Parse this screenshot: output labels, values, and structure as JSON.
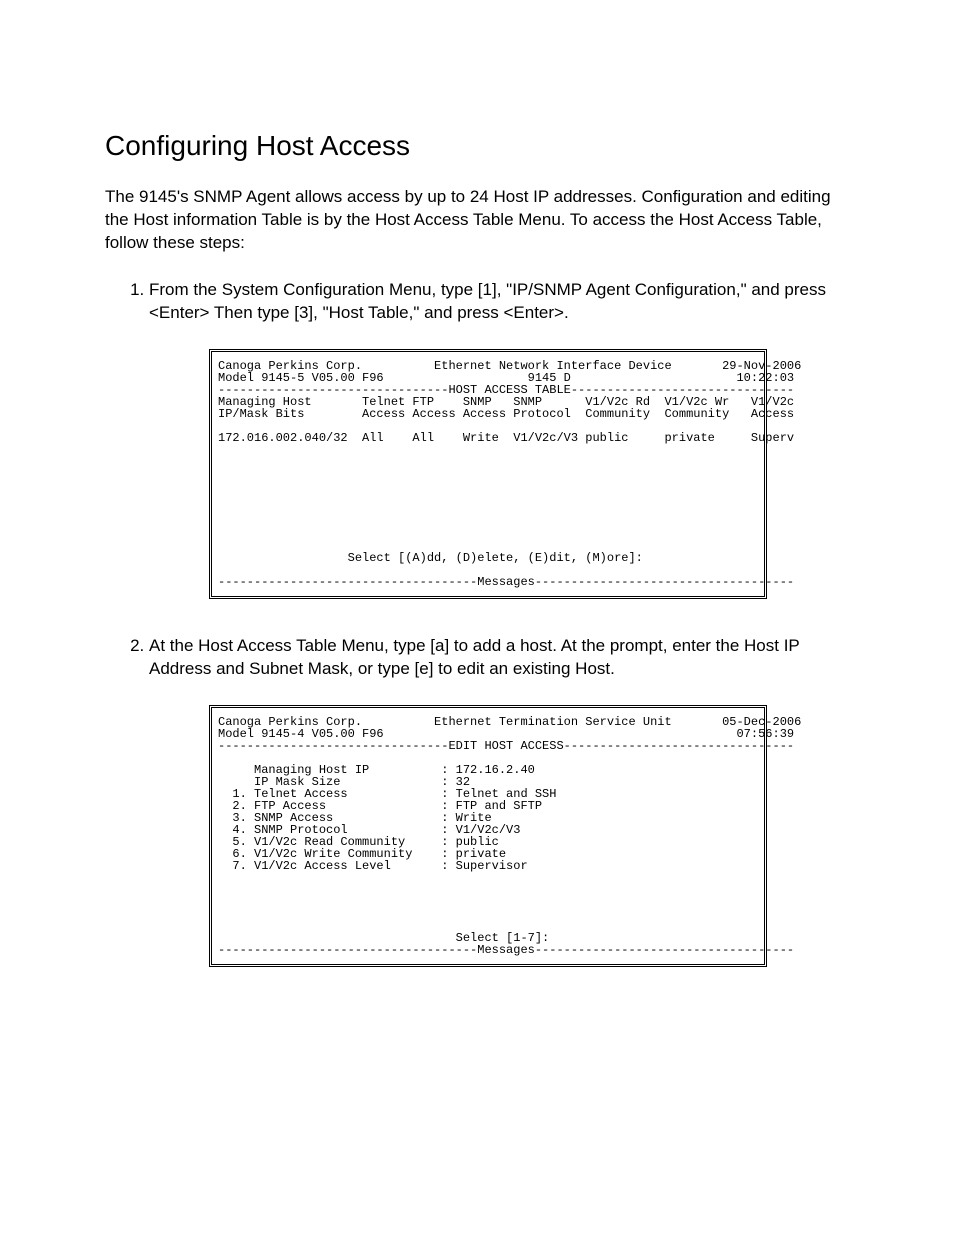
{
  "title": "Configuring Host Access",
  "intro": "The 9145's SNMP Agent allows access by up to 24 Host IP addresses.  Configuration and editing the Host information Table is by the Host Access Table Menu.  To access the Host Access Table, follow these steps:",
  "step1": "From the System Configuration Menu, type [1], \"IP/SNMP Agent Configuration,\" and press <Enter>  Then type [3], \"Host Table,\" and press <Enter>.",
  "step2": "At the Host Access Table Menu, type [a]  to add a host.  At the prompt, enter the Host IP Address and Subnet Mask, or type [e] to edit an existing Host.",
  "screen1": "Canoga Perkins Corp.          Ethernet Network Interface Device       29-Nov-2006\nModel 9145-5 V05.00 F96                    9145 D                       10:22:03\n--------------------------------HOST ACCESS TABLE-------------------------------\nManaging Host       Telnet FTP    SNMP   SNMP      V1/V2c Rd  V1/V2c Wr   V1/V2c\nIP/Mask Bits        Access Access Access Protocol  Community  Community   Access\n\n172.016.002.040/32  All    All    Write  V1/V2c/V3 public     private     Superv\n\n\n\n\n\n\n\n\n\n                  Select [(A)dd, (D)elete, (E)dit, (M)ore]:\n\n------------------------------------Messages------------------------------------\n",
  "screen2": "Canoga Perkins Corp.          Ethernet Termination Service Unit       05-Dec-2006\nModel 9145-4 V05.00 F96                                                 07:56:39\n--------------------------------EDIT HOST ACCESS--------------------------------\n\n     Managing Host IP          : 172.16.2.40\n     IP Mask Size              : 32\n  1. Telnet Access             : Telnet and SSH\n  2. FTP Access                : FTP and SFTP\n  3. SNMP Access               : Write\n  4. SNMP Protocol             : V1/V2c/V3\n  5. V1/V2c Read Community     : public\n  6. V1/V2c Write Community    : private\n  7. V1/V2c Access Level       : Supervisor\n\n\n\n\n\n                                 Select [1-7]:\n------------------------------------Messages------------------------------------\n",
  "chart_data": {
    "type": "table",
    "host_access_table": {
      "header": {
        "vendor": "Canoga Perkins Corp.",
        "device": "Ethernet Network Interface Device",
        "date": "29-Nov-2006",
        "model": "Model 9145-5 V05.00 F96",
        "device_name": "9145 D",
        "time": "10:22:03"
      },
      "columns": [
        "Managing Host IP/Mask Bits",
        "Telnet Access",
        "FTP Access",
        "SNMP Access",
        "SNMP Protocol",
        "V1/V2c Rd Community",
        "V1/V2c Wr Community",
        "V1/V2c Access"
      ],
      "rows": [
        [
          "172.016.002.040/32",
          "All",
          "All",
          "Write",
          "V1/V2c/V3",
          "public",
          "private",
          "Superv"
        ]
      ],
      "prompt": "Select [(A)dd, (D)elete, (E)dit, (M)ore]:"
    },
    "edit_host_access": {
      "header": {
        "vendor": "Canoga Perkins Corp.",
        "device": "Ethernet Termination Service Unit",
        "date": "05-Dec-2006",
        "model": "Model 9145-4 V05.00 F96",
        "time": "07:56:39"
      },
      "fields": [
        {
          "label": "Managing Host IP",
          "value": "172.16.2.40"
        },
        {
          "label": "IP Mask Size",
          "value": "32"
        },
        {
          "num": 1,
          "label": "Telnet Access",
          "value": "Telnet and SSH"
        },
        {
          "num": 2,
          "label": "FTP Access",
          "value": "FTP and SFTP"
        },
        {
          "num": 3,
          "label": "SNMP Access",
          "value": "Write"
        },
        {
          "num": 4,
          "label": "SNMP Protocol",
          "value": "V1/V2c/V3"
        },
        {
          "num": 5,
          "label": "V1/V2c Read Community",
          "value": "public"
        },
        {
          "num": 6,
          "label": "V1/V2c Write Community",
          "value": "private"
        },
        {
          "num": 7,
          "label": "V1/V2c Access Level",
          "value": "Supervisor"
        }
      ],
      "prompt": "Select [1-7]:"
    }
  }
}
